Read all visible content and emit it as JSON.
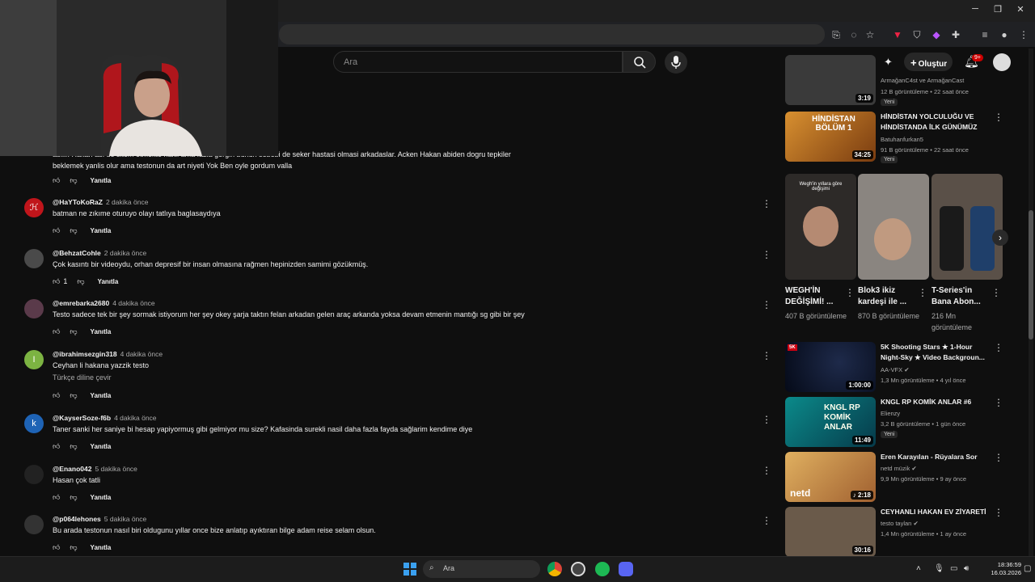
{
  "window": {
    "minimize_glyph": "─",
    "maximize_glyph": "❐",
    "close_glyph": "✕"
  },
  "youtube": {
    "search_placeholder": "Ara",
    "create_label": "Oluştur",
    "notification_count": "9+"
  },
  "comments": [
    {
      "author": "",
      "time": "",
      "text": "abilir. Hakan abi de sitem etmekte hakli ama fazla gergin bunun sebebi de seker hastasi olmasi arkadaslar. Acken Hakan abiden dogru tepkiler",
      "text2": "beklemek yanlis olur ama testonun da art niyeti Yok Ben oyle gordum valla",
      "likes": "",
      "reply": "Yanıtla"
    },
    {
      "author": "@HaYToKoRaZ",
      "time": "2 dakika önce",
      "text": "batman ne zıkıme oturuyo olayı tatlıya baglasaydıya",
      "likes": "",
      "reply": "Yanıtla",
      "avatar_letter": "",
      "avatar_color": "#c0151b"
    },
    {
      "author": "@BehzatCohle",
      "time": "2 dakika önce",
      "text": "Çok kasıntı bir videoydu, orhan depresif bir insan olmasına rağmen hepinizden samimi gözükmüş.",
      "likes": "1",
      "reply": "Yanıtla",
      "avatar_letter": "",
      "avatar_color": "#4a4a4a"
    },
    {
      "author": "@emrebarka2680",
      "time": "4 dakika önce",
      "text": "Testo sadece tek bir şey sormak istiyorum her şey okey şarja taktın felan arkadan gelen araç arkanda yoksa devam etmenin mantığı sg gibi bir şey",
      "likes": "",
      "reply": "Yanıtla",
      "avatar_letter": "",
      "avatar_color": "#5a3a4a"
    },
    {
      "author": "@ibrahimsezgin318",
      "time": "4 dakika önce",
      "text": "Ceyhan li hakana yazzik testo",
      "translate": "Türkçe diline çevir",
      "likes": "",
      "reply": "Yanıtla",
      "avatar_letter": "I",
      "avatar_color": "#7cb342"
    },
    {
      "author": "@KayserSoze-f6b",
      "time": "4 dakika önce",
      "text": "Taner sanki her saniye bi hesap yapiyormuş gibi gelmiyor mu size?   Kafasinda surekli nasil daha fazla fayda sağlarim kendime diye",
      "likes": "",
      "reply": "Yanıtla",
      "avatar_letter": "k",
      "avatar_color": "#1e63b5"
    },
    {
      "author": "@Enano042",
      "time": "5 dakika önce",
      "text": "Hasan çok tatli",
      "likes": "",
      "reply": "Yanıtla",
      "avatar_letter": "",
      "avatar_color": "#222"
    },
    {
      "author": "@p064lehones",
      "time": "5 dakika önce",
      "text": "Bu arada testonun nasıl biri oldugunu yıllar once bize anlatıp ayıktıran bilge adam reise selam olsun.",
      "likes": "",
      "reply": "Yanıtla",
      "avatar_letter": "",
      "avatar_color": "#333"
    }
  ],
  "sidebar": {
    "top_items": [
      {
        "title": "",
        "channel": "ArmağanC4st ve ArmağanCast",
        "meta": "12 B görüntüleme • 22 saat önce",
        "badge": "Yeni",
        "duration": "3:19",
        "thumb_color": "#3a3a3a"
      },
      {
        "title": "HİNDİSTAN YOLCULUĞU VE HİNDİSTANDA İLK GÜNÜMÜZ",
        "channel": "Batuhanfurkan5",
        "meta": "91 B görüntüleme • 22 saat önce",
        "badge": "Yeni",
        "duration": "34:25",
        "thumb_color": "#c47a1c",
        "thumb_text": "HİNDİSTAN BÖLÜM 1"
      }
    ],
    "shorts": [
      {
        "title": "WEGH'İN DEĞİŞİMİ! ...",
        "views": "407 B görüntüleme",
        "thumb_color": "#2d2a28",
        "thumb_text": "Wegh'in yıllara göre değişimi"
      },
      {
        "title": "Blok3 ikiz kardeşi ile ...",
        "views": "870 B görüntüleme",
        "thumb_color": "#8a8580"
      },
      {
        "title": "T-Series'in Bana Abon...",
        "views": "216 Mn görüntüleme",
        "thumb_color": "#5a5048"
      }
    ],
    "bottom_items": [
      {
        "title": "5K Shooting Stars ★ 1-Hour Night-Sky ★ Video Backgroun...",
        "channel": "AA-VFX",
        "meta": "1,3 Mn görüntüleme • 4 yıl önce",
        "duration": "1:00:00",
        "thumb_color": "#0a1428"
      },
      {
        "title": "KNGL RP KOMİK ANLAR #6",
        "channel": "Elienzy",
        "meta": "3,2 B görüntüleme • 1 gün önce",
        "badge": "Yeni",
        "duration": "11:49",
        "thumb_color": "#0e6e6e",
        "thumb_text": "KNGL RP KOMİK ANLAR"
      },
      {
        "title": "Eren Karayılan - Rüyalara Sor",
        "channel": "netd müzik",
        "meta": "9,9 Mn görüntüleme • 9 ay önce",
        "duration": "2:18",
        "thumb_color": "#d8a050",
        "thumb_text": "netd"
      },
      {
        "title": "CEYHANLI HAKAN EV ZİYARETİ",
        "channel": "testo taylan",
        "meta": "1,4 Mn görüntüleme • 1 ay önce",
        "duration": "30:16",
        "thumb_color": "#6a5a4a"
      }
    ]
  },
  "taskbar": {
    "search_label": "Ara",
    "time": "18:36:59",
    "date": "16.03.2026"
  }
}
